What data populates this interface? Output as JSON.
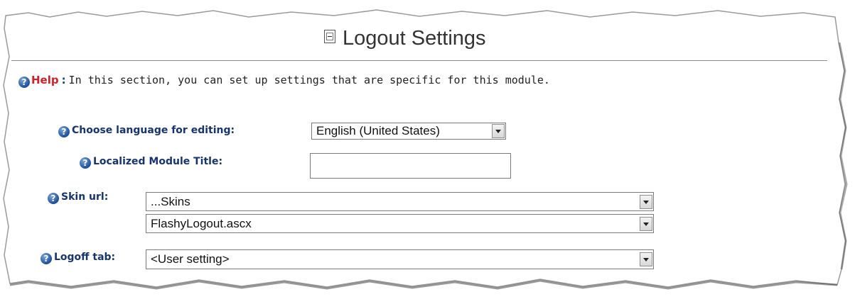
{
  "header": {
    "title": "Logout Settings",
    "collapse_icon": "minus-box-icon"
  },
  "help": {
    "label": "Help",
    "separator": ":",
    "text": "In this section, you can set up settings that are specific for this module."
  },
  "fields": {
    "language": {
      "label": "Choose language for editing:",
      "value": "English (United States)"
    },
    "localized_title": {
      "label": "Localized Module Title:",
      "value": ""
    },
    "skin_url": {
      "label": "Skin url:",
      "folder_value": "...Skins",
      "file_value": "FlashyLogout.ascx"
    },
    "logoff_tab": {
      "label": "Logoff tab:",
      "value": "<User setting>"
    }
  },
  "icons": {
    "help": "question-circle-icon",
    "dropdown": "chevron-down-icon"
  },
  "colors": {
    "label": "#16346e",
    "help_word": "#d0202a",
    "help_icon": "#1e4f9a"
  }
}
